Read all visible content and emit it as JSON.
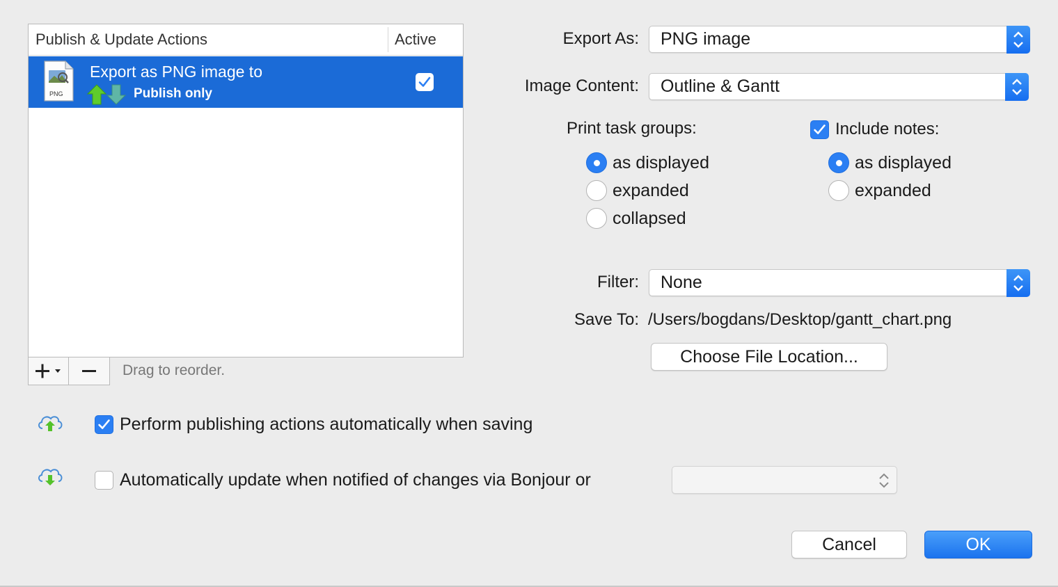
{
  "table": {
    "col_actions": "Publish & Update Actions",
    "col_active": "Active",
    "rows": [
      {
        "title": "Export as PNG image to",
        "subtitle": "Publish only",
        "file_type": "PNG",
        "active": true
      }
    ]
  },
  "toolbar": {
    "add_label": "+",
    "remove_label": "−",
    "drag_hint": "Drag to reorder."
  },
  "form": {
    "export_as_label": "Export As:",
    "export_as_value": "PNG image",
    "image_content_label": "Image Content:",
    "image_content_value": "Outline & Gantt",
    "print_groups_label": "Print task groups:",
    "print_groups_options": [
      "as displayed",
      "expanded",
      "collapsed"
    ],
    "print_groups_selected": "as displayed",
    "include_notes_label": "Include notes:",
    "include_notes_checked": true,
    "notes_options": [
      "as displayed",
      "expanded"
    ],
    "notes_selected": "as displayed",
    "filter_label": "Filter:",
    "filter_value": "None",
    "save_to_label": "Save To:",
    "save_to_value": "/Users/bogdans/Desktop/gantt_chart.png",
    "choose_location_label": "Choose File Location..."
  },
  "options": {
    "auto_publish_label": "Perform publishing actions automatically when saving",
    "auto_publish_checked": true,
    "auto_update_label": "Automatically update when notified of changes via Bonjour or",
    "auto_update_checked": false,
    "auto_update_source_value": ""
  },
  "buttons": {
    "cancel_label": "Cancel",
    "ok_label": "OK"
  },
  "colors": {
    "accent": "#2b7ff3",
    "selection": "#1b6bd7",
    "window_bg": "#ececec",
    "upload_green": "#54c22a",
    "cloud_blue": "#4a8ed6"
  }
}
